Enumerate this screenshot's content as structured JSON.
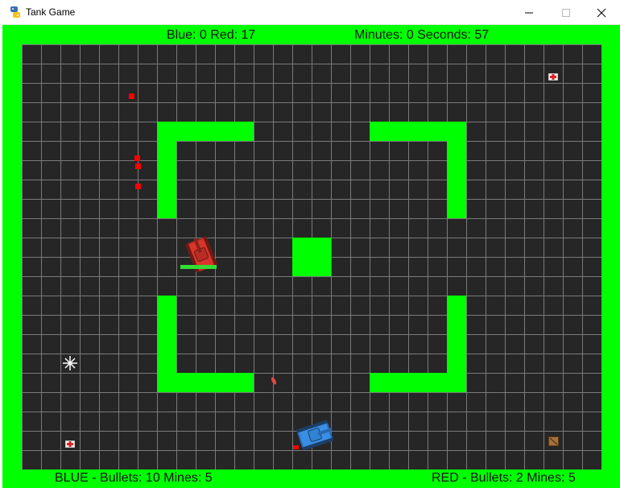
{
  "window": {
    "title": "Tank Game",
    "controls": [
      "minimize-icon",
      "maximize-icon",
      "close-icon"
    ]
  },
  "hud": {
    "score": "Blue: 0  Red: 17",
    "timer": "Minutes: 0 Seconds: 57",
    "blue_status": "BLUE - Bullets: 10 Mines: 5",
    "red_status": "RED - Bullets: 2 Mines: 5"
  },
  "colors": {
    "border_green": "#00ff00",
    "arena_bg": "#262626",
    "grid_line": "#7a7a7a",
    "red_tank": "#d9352b",
    "blue_tank": "#3a8ee6",
    "mine": "#ff0000",
    "health_bar": "#33dd33"
  },
  "entities": {
    "red_tank": {
      "icon": "red-tank-icon",
      "health": 1.0
    },
    "blue_tank": {
      "icon": "blue-tank-icon"
    },
    "mines": 5,
    "pickups": [
      "health-pickup-icon",
      "health-pickup-icon",
      "ammo-crate-icon"
    ],
    "effects": [
      "explosion-spark-icon",
      "bullet-icon"
    ]
  }
}
